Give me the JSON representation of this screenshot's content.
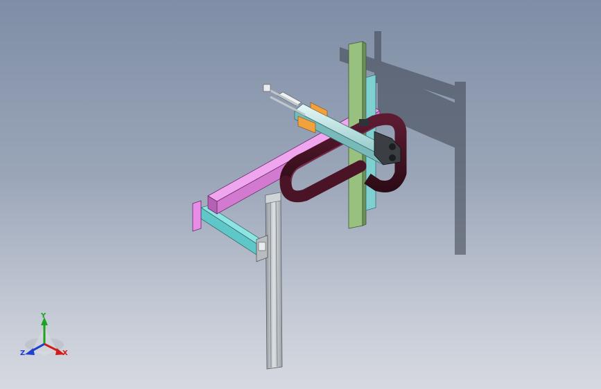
{
  "triad": {
    "x_label": "X",
    "y_label": "Y",
    "z_label": "Z",
    "x_color": "#d21c1c",
    "y_color": "#1fa21f",
    "z_color": "#2040d0"
  },
  "colors": {
    "background_top": "#7f8ea6",
    "background_bottom": "#d6d9e0",
    "beam": "#e98ce8",
    "rail": "#8fb47a",
    "profile": "#b9bfc3",
    "bracket": "#7ad9d9",
    "cable_chain": "#4a1426",
    "shadow": "#3d4450"
  }
}
